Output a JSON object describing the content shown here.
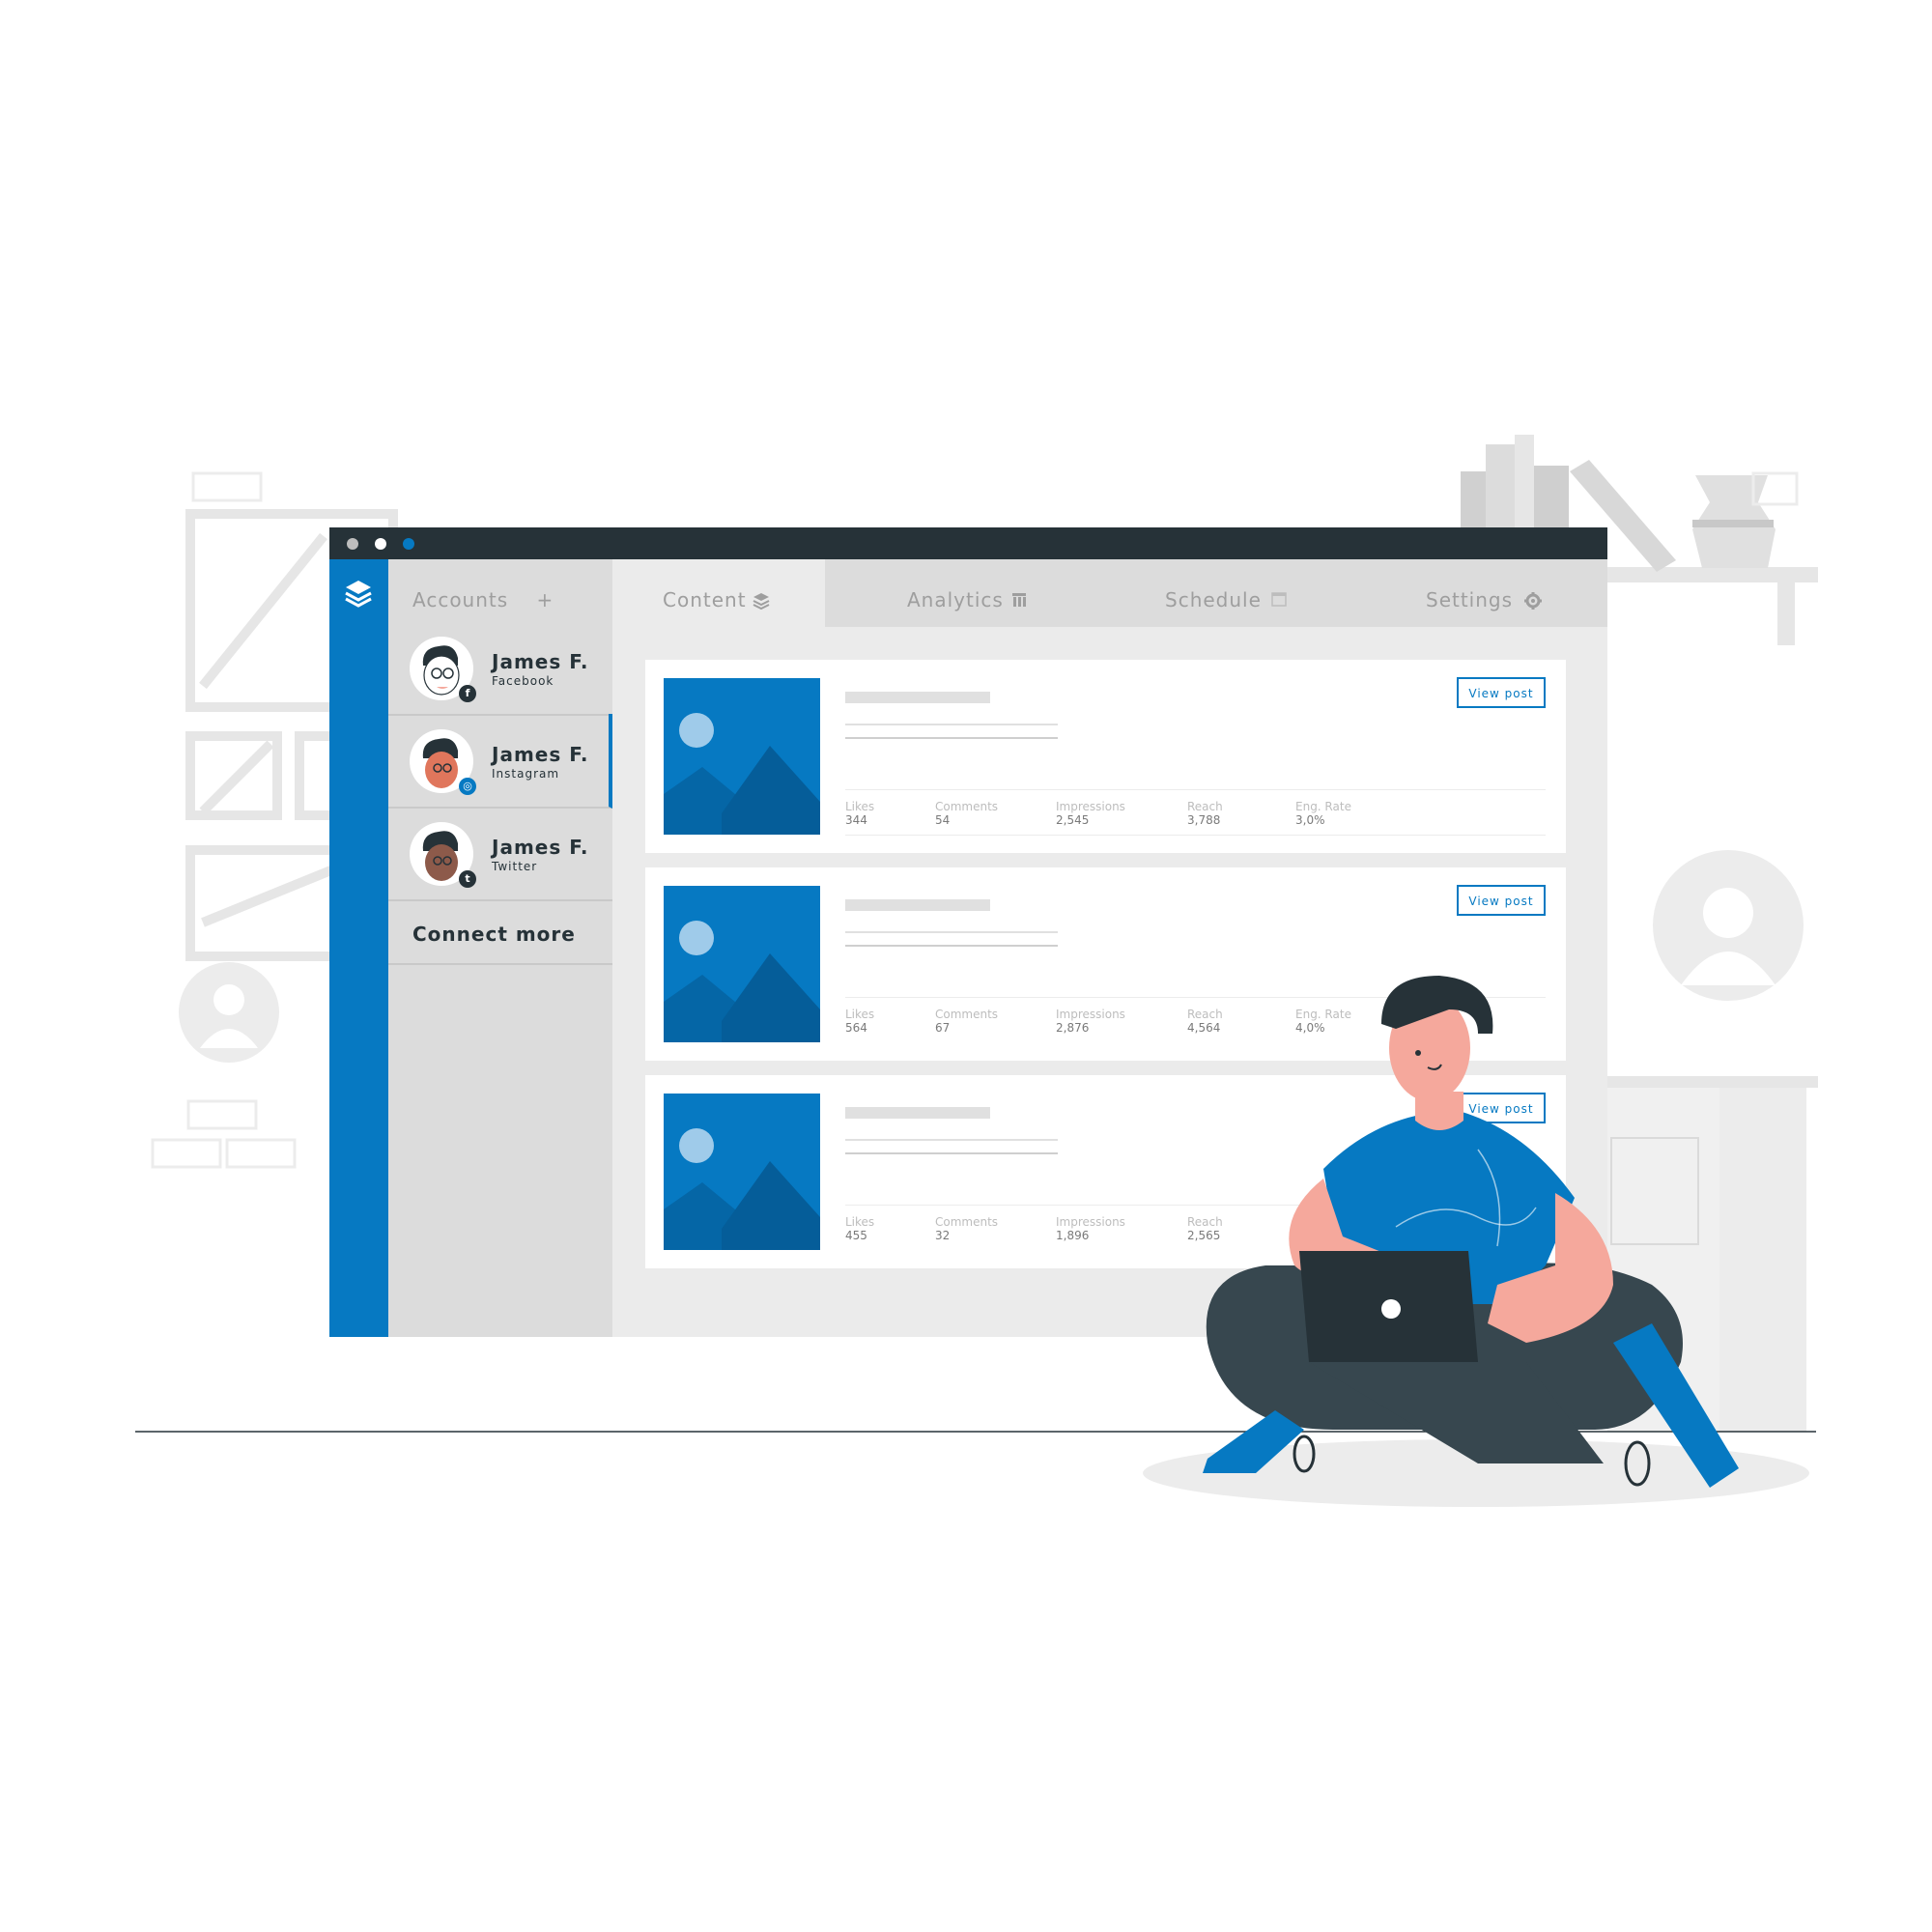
{
  "window": {
    "accounts_header": "Accounts",
    "add_symbol": "+",
    "tabs": [
      {
        "label": "Content",
        "icon": "layers-icon"
      },
      {
        "label": "Analytics",
        "icon": "bar-chart-icon"
      },
      {
        "label": "Schedule",
        "icon": "calendar-icon"
      },
      {
        "label": "Settings",
        "icon": "gear-icon"
      }
    ],
    "accounts": [
      {
        "name": "James F.",
        "network": "Facebook",
        "badge": "f"
      },
      {
        "name": "James F.",
        "network": "Instagram",
        "badge": "◎"
      },
      {
        "name": "James F.",
        "network": "Twitter",
        "badge": "t"
      }
    ],
    "connect_more": "Connect more",
    "posts": [
      {
        "button": "View post",
        "stats": {
          "Likes": "344",
          "Comments": "54",
          "Impressions": "2,545",
          "Reach": "3,788",
          "Eng. Rate": "3,0%"
        }
      },
      {
        "button": "View post",
        "stats": {
          "Likes": "564",
          "Comments": "67",
          "Impressions": "2,876",
          "Reach": "4,564",
          "Eng. Rate": "4,0%"
        }
      },
      {
        "button": "View post",
        "stats": {
          "Likes": "455",
          "Comments": "32",
          "Impressions": "1,896",
          "Reach": "2,565"
        }
      }
    ],
    "stat_labels": [
      "Likes",
      "Comments",
      "Impressions",
      "Reach",
      "Eng. Rate"
    ]
  },
  "colors": {
    "accent": "#0679c2",
    "titlebar": "#263238",
    "panel": "#dcdcdc",
    "background": "#ebebeb",
    "skin": "#f5a89c"
  }
}
